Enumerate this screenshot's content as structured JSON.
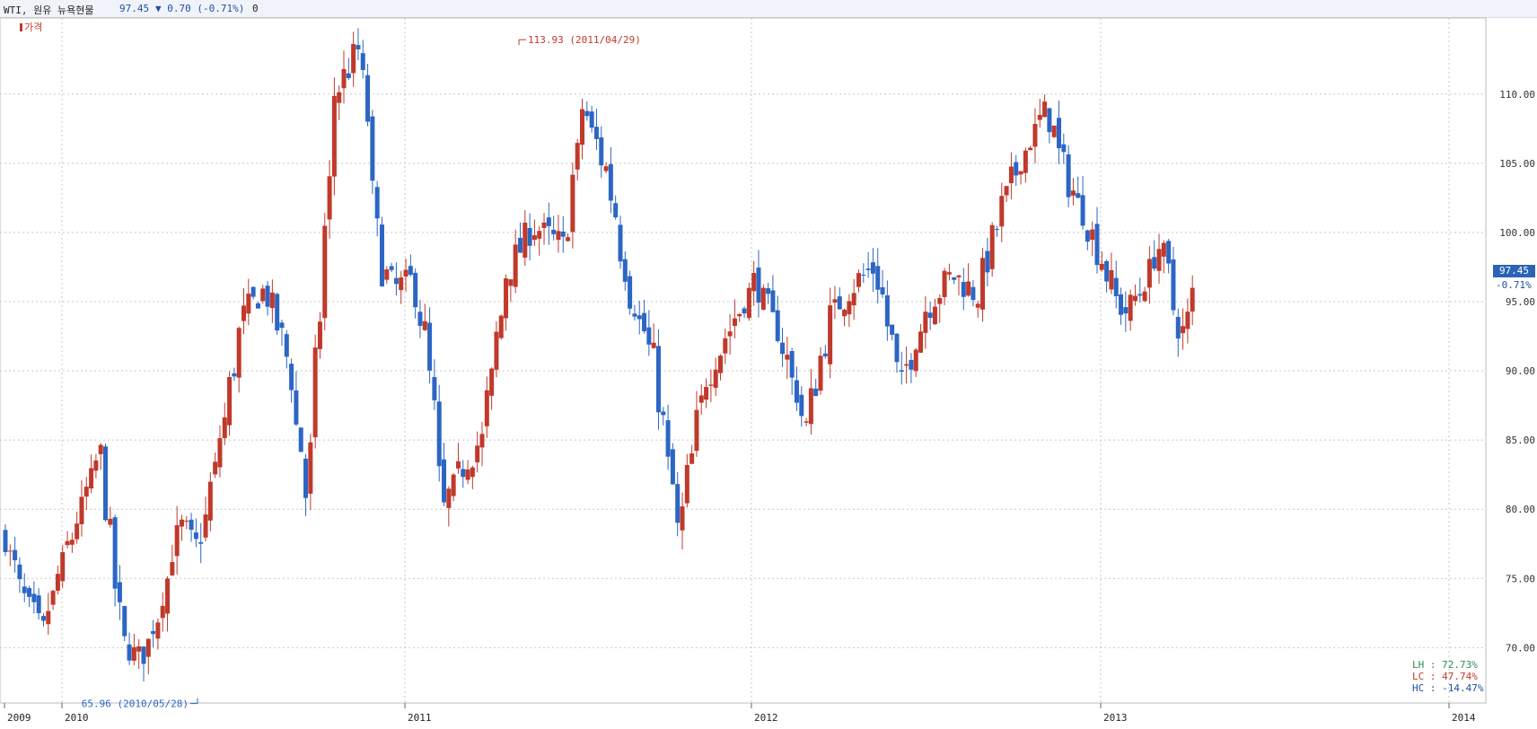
{
  "header": {
    "title": "WTI, 원유 뉴욕현물",
    "price": "97.45",
    "change": "▼ 0.70 (-0.71%)",
    "zero": "0"
  },
  "legend": {
    "label": "가격"
  },
  "colors": {
    "up": "#c0392b",
    "down": "#2c66c4",
    "grid": "#c8c8c8"
  },
  "annotations": {
    "high": "113.93 (2011/04/29)",
    "low": "65.96 (2010/05/28)"
  },
  "last": {
    "value": "97.45",
    "pct": "-0.71%"
  },
  "stats": [
    {
      "label": "LH :",
      "value": "72.73%",
      "color": "#2e8b57"
    },
    {
      "label": "LC :",
      "value": "47.74%",
      "color": "#c0392b"
    },
    {
      "label": "HC :",
      "value": "-14.47%",
      "color": "#1f4f9f"
    }
  ],
  "chart_data": {
    "type": "candlestick",
    "period": "weekly",
    "y_ticks": [
      "70.00",
      "75.00",
      "80.00",
      "85.00",
      "90.00",
      "95.00",
      "100.00",
      "105.00",
      "110.00"
    ],
    "ylim": [
      66.0,
      115.5
    ],
    "x_labels": [
      "2009",
      "2010",
      "2011",
      "2012",
      "2013",
      "2014"
    ],
    "grid": true,
    "close_path": [
      [
        0,
        78.0
      ],
      [
        6,
        73.5
      ],
      [
        12,
        71.2
      ],
      [
        18,
        76.0
      ],
      [
        24,
        80.0
      ],
      [
        30,
        84.0
      ],
      [
        37,
        70.5
      ],
      [
        43,
        69.0
      ],
      [
        49,
        73.0
      ],
      [
        55,
        79.0
      ],
      [
        61,
        77.0
      ],
      [
        67,
        84.0
      ],
      [
        75,
        94.0
      ],
      [
        82,
        96.0
      ],
      [
        89,
        91.0
      ],
      [
        95,
        81.0
      ],
      [
        104,
        110.0
      ],
      [
        112,
        113.6
      ],
      [
        118,
        97.5
      ],
      [
        123,
        96.0
      ],
      [
        128,
        96.5
      ],
      [
        133,
        92.0
      ],
      [
        138,
        80.0
      ],
      [
        144,
        83.0
      ],
      [
        150,
        85.0
      ],
      [
        158,
        97.0
      ],
      [
        166,
        100.5
      ],
      [
        176,
        99.0
      ],
      [
        182,
        109.0
      ],
      [
        190,
        104.0
      ],
      [
        196,
        96.0
      ],
      [
        204,
        91.0
      ],
      [
        212,
        78.5
      ],
      [
        220,
        89.0
      ],
      [
        228,
        93.0
      ],
      [
        236,
        96.5
      ],
      [
        244,
        92.5
      ],
      [
        252,
        86.0
      ],
      [
        260,
        94.0
      ],
      [
        268,
        96.5
      ],
      [
        274,
        97.5
      ],
      [
        282,
        89.0
      ],
      [
        290,
        94.5
      ],
      [
        298,
        97.0
      ],
      [
        306,
        95.5
      ],
      [
        314,
        102.0
      ],
      [
        320,
        105.5
      ],
      [
        328,
        109.0
      ],
      [
        334,
        104.0
      ],
      [
        340,
        101.0
      ],
      [
        346,
        97.5
      ],
      [
        352,
        94.0
      ],
      [
        358,
        96.0
      ],
      [
        364,
        99.5
      ],
      [
        370,
        92.0
      ],
      [
        374,
        95.5
      ]
    ]
  }
}
